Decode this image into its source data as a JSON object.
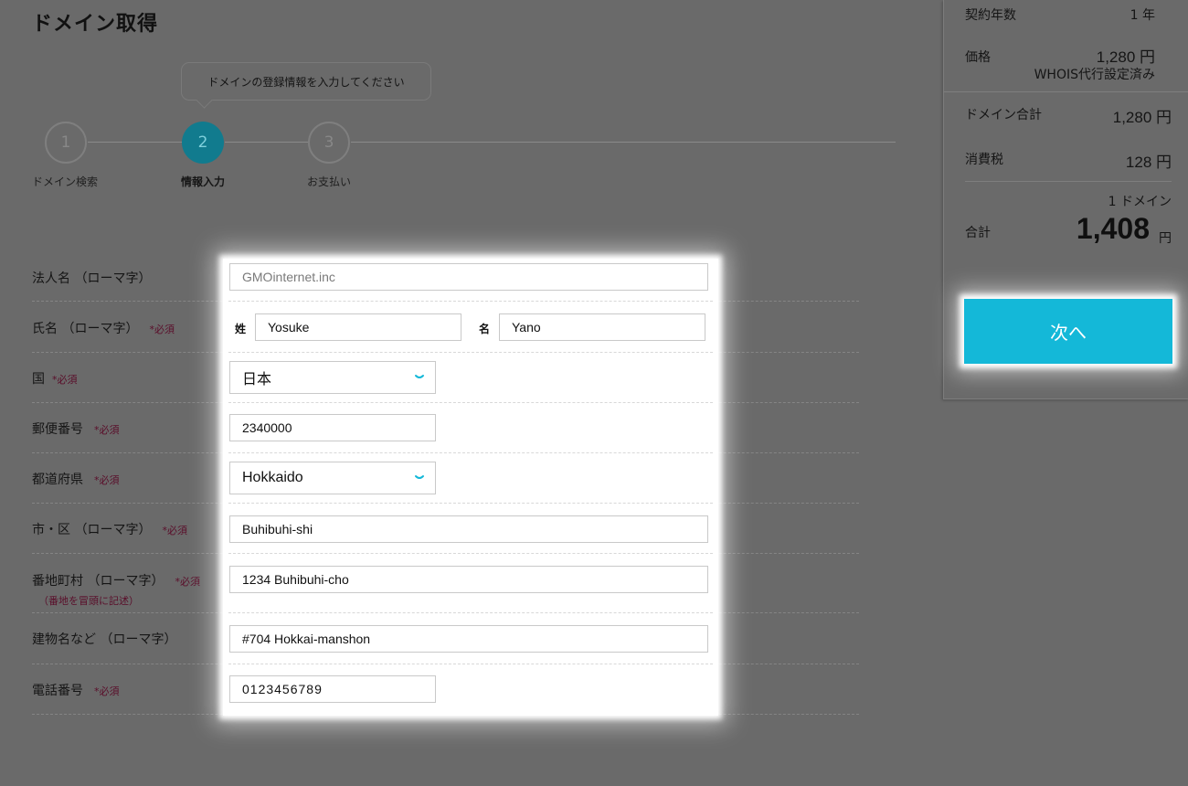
{
  "page_title": "ドメイン取得",
  "stepper": {
    "tooltip": "ドメインの登録情報を入力してください",
    "steps": [
      {
        "number": "1",
        "label": "ドメイン検索"
      },
      {
        "number": "2",
        "label": "情報入力"
      },
      {
        "number": "3",
        "label": "お支払い"
      }
    ],
    "active_step": 2
  },
  "form": {
    "required_mark": "*必須",
    "company_name": {
      "label": "法人名 （ローマ字）",
      "value": "GMOinternet.inc"
    },
    "full_name": {
      "label": "氏名 （ローマ字）",
      "last_label": "姓",
      "last_value": "Yosuke",
      "first_label": "名",
      "first_value": "Yano"
    },
    "country": {
      "label": "国",
      "value": "日本"
    },
    "postal_code": {
      "label": "郵便番号",
      "value": "2340000"
    },
    "prefecture": {
      "label": "都道府県",
      "value": "Hokkaido"
    },
    "city": {
      "label": "市・区 （ローマ字）",
      "value": "Buhibuhi-shi"
    },
    "street": {
      "label": "番地町村 （ローマ字）",
      "note": "（番地を冒頭に記述）",
      "value": "1234 Buhibuhi-cho"
    },
    "building": {
      "label": "建物名など （ローマ字）",
      "value": "#704 Hokkai-manshon"
    },
    "phone": {
      "label": "電話番号",
      "value": "0123456789"
    }
  },
  "summary": {
    "contract_years_label": "契約年数",
    "contract_years_value": "1 年",
    "price_label": "価格",
    "price_value": "1,280 円",
    "price_note": "WHOIS代行設定済み",
    "domain_total_label": "ドメイン合計",
    "domain_total_value": "1,280 円",
    "tax_label": "消費税",
    "tax_value": "128 円",
    "domain_count": "1 ドメイン",
    "total_label": "合計",
    "total_value": "1,408",
    "total_unit": "円"
  },
  "next_button": "次へ",
  "colors": {
    "accent": "#14b8d8",
    "step_active": "#117b8e",
    "required": "#5a0e2a"
  }
}
